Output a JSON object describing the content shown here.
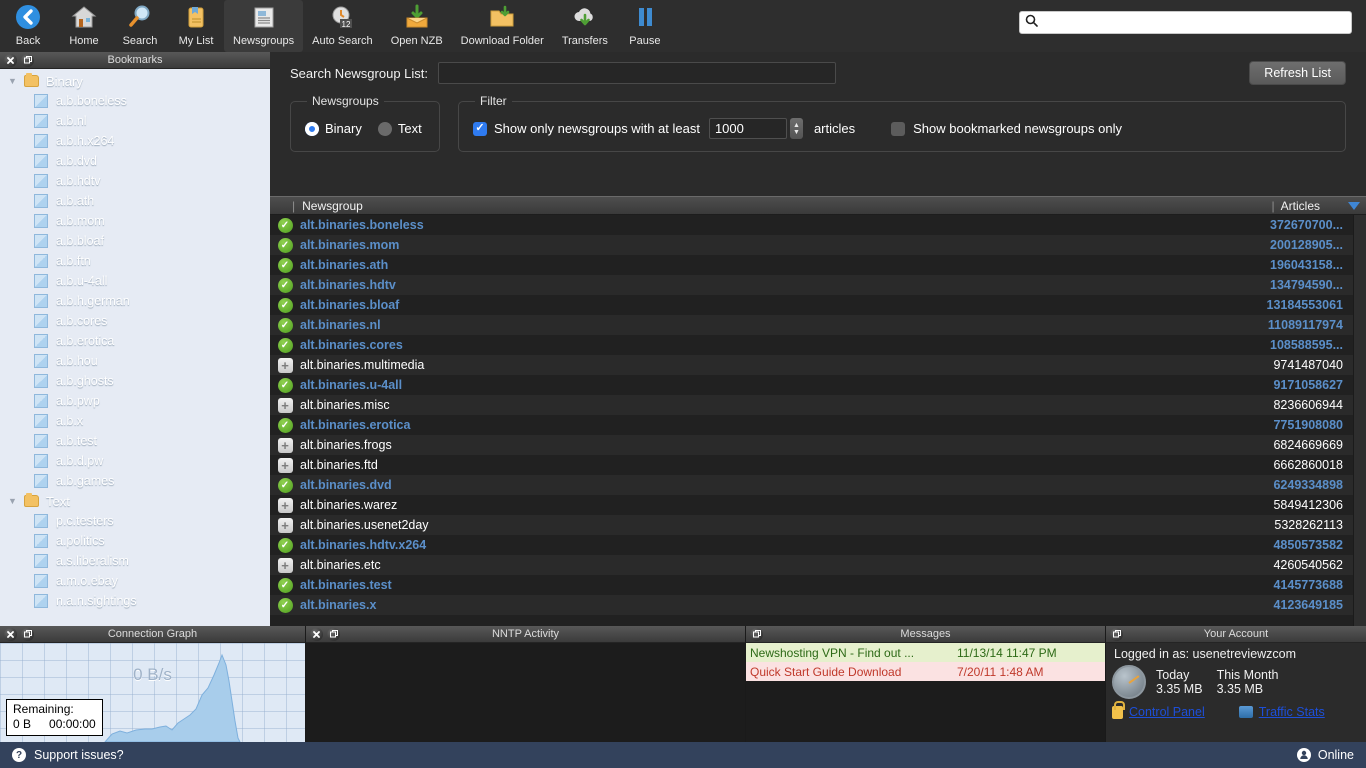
{
  "toolbar": {
    "items": [
      {
        "label": "Back",
        "icon": "back-arrow-icon",
        "active": false
      },
      {
        "label": "Home",
        "icon": "home-icon",
        "active": false
      },
      {
        "label": "Search",
        "icon": "magnifier-icon",
        "active": false
      },
      {
        "label": "My List",
        "icon": "clipboard-icon",
        "active": false
      },
      {
        "label": "Newsgroups",
        "icon": "newspaper-icon",
        "active": true
      },
      {
        "label": "Auto Search",
        "icon": "clock-calendar-icon",
        "active": false
      },
      {
        "label": "Open NZB",
        "icon": "open-envelope-icon",
        "active": false
      },
      {
        "label": "Download Folder",
        "icon": "folder-download-icon",
        "active": false
      },
      {
        "label": "Transfers",
        "icon": "cloud-download-icon",
        "active": false
      },
      {
        "label": "Pause",
        "icon": "pause-icon",
        "active": false
      }
    ],
    "search": {
      "value": "",
      "placeholder": ""
    }
  },
  "sidebar": {
    "title": "Bookmarks",
    "groups": [
      {
        "name": "Binary",
        "expanded": true,
        "items": [
          "a.b.boneless",
          "a.b.nl",
          "a.b.h.x264",
          "a.b.dvd",
          "a.b.hdtv",
          "a.b.ath",
          "a.b.mom",
          "a.b.bloaf",
          "a.b.ftn",
          "a.b.u-4all",
          "a.b.h.german",
          "a.b.cores",
          "a.b.erotica",
          "a.b.hou",
          "a.b.ghosts",
          "a.b.pwp",
          "a.b.x",
          "a.b.test",
          "a.b.d.pw",
          "a.b.games"
        ]
      },
      {
        "name": "Text",
        "expanded": true,
        "items": [
          "p.c.testers",
          "a.politics",
          "a.s.liberalism",
          "a.m.o.ebay",
          "n.a.n.sightings"
        ]
      }
    ]
  },
  "main": {
    "search_label": "Search Newsgroup List:",
    "search_value": "",
    "search_placeholder": "",
    "refresh_label": "Refresh List",
    "newsgroups_legend": "Newsgroups",
    "radio_binary": "Binary",
    "radio_text": "Text",
    "selected_kind": "Binary",
    "filter_legend": "Filter",
    "filter_checkbox_label": "Show only newsgroups with at least",
    "min_articles": "1000",
    "articles_label": "articles",
    "bookmarked_only_label": "Show bookmarked newsgroups only",
    "bookmarked_only_checked": false
  },
  "table": {
    "col_newsgroup": "Newsgroup",
    "col_articles": "Articles",
    "sort_dir": "desc",
    "rows": [
      {
        "name": "alt.binaries.boneless",
        "articles": "372670700...",
        "bookmarked": true
      },
      {
        "name": "alt.binaries.mom",
        "articles": "200128905...",
        "bookmarked": true
      },
      {
        "name": "alt.binaries.ath",
        "articles": "196043158...",
        "bookmarked": true
      },
      {
        "name": "alt.binaries.hdtv",
        "articles": "134794590...",
        "bookmarked": true
      },
      {
        "name": "alt.binaries.bloaf",
        "articles": "13184553061",
        "bookmarked": true
      },
      {
        "name": "alt.binaries.nl",
        "articles": "11089117974",
        "bookmarked": true
      },
      {
        "name": "alt.binaries.cores",
        "articles": "108588595...",
        "bookmarked": true
      },
      {
        "name": "alt.binaries.multimedia",
        "articles": "9741487040",
        "bookmarked": false
      },
      {
        "name": "alt.binaries.u-4all",
        "articles": "9171058627",
        "bookmarked": true
      },
      {
        "name": "alt.binaries.misc",
        "articles": "8236606944",
        "bookmarked": false
      },
      {
        "name": "alt.binaries.erotica",
        "articles": "7751908080",
        "bookmarked": true
      },
      {
        "name": "alt.binaries.frogs",
        "articles": "6824669669",
        "bookmarked": false
      },
      {
        "name": "alt.binaries.ftd",
        "articles": "6662860018",
        "bookmarked": false
      },
      {
        "name": "alt.binaries.dvd",
        "articles": "6249334898",
        "bookmarked": true
      },
      {
        "name": "alt.binaries.warez",
        "articles": "5849412306",
        "bookmarked": false
      },
      {
        "name": "alt.binaries.usenet2day",
        "articles": "5328262113",
        "bookmarked": false
      },
      {
        "name": "alt.binaries.hdtv.x264",
        "articles": "4850573582",
        "bookmarked": true
      },
      {
        "name": "alt.binaries.etc",
        "articles": "4260540562",
        "bookmarked": false
      },
      {
        "name": "alt.binaries.test",
        "articles": "4145773688",
        "bookmarked": true
      },
      {
        "name": "alt.binaries.x",
        "articles": "4123649185",
        "bookmarked": true
      }
    ]
  },
  "docks": {
    "graph": {
      "title": "Connection Graph",
      "rate": "0 B/s",
      "remaining_label": "Remaining:",
      "remaining_size": "0 B",
      "remaining_time": "00:00:00"
    },
    "nntp": {
      "title": "NNTP Activity"
    },
    "messages": {
      "title": "Messages",
      "rows": [
        {
          "text": "Newshosting VPN - Find out ...",
          "date": "11/13/14 11:47 PM",
          "tone": "green"
        },
        {
          "text": "Quick Start Guide Download",
          "date": "7/20/11 1:48 AM",
          "tone": "red"
        }
      ]
    },
    "account": {
      "title": "Your Account",
      "logged_in": "Logged in as: usenetreviewzcom",
      "col_today": "Today",
      "col_month": "This Month",
      "val_today": "3.35 MB",
      "val_month": "3.35 MB",
      "link_control_panel": "Control Panel",
      "link_traffic_stats": "Traffic Stats"
    }
  },
  "statusbar": {
    "support": "Support issues?",
    "online": "Online"
  },
  "colors": {
    "accent": "#5b8fc9",
    "status_bar": "#33425c",
    "checkbox_blue": "#2f7bf0",
    "bookmark_green": "#6eb635",
    "sidebar_bg": "#e6ebf4"
  }
}
